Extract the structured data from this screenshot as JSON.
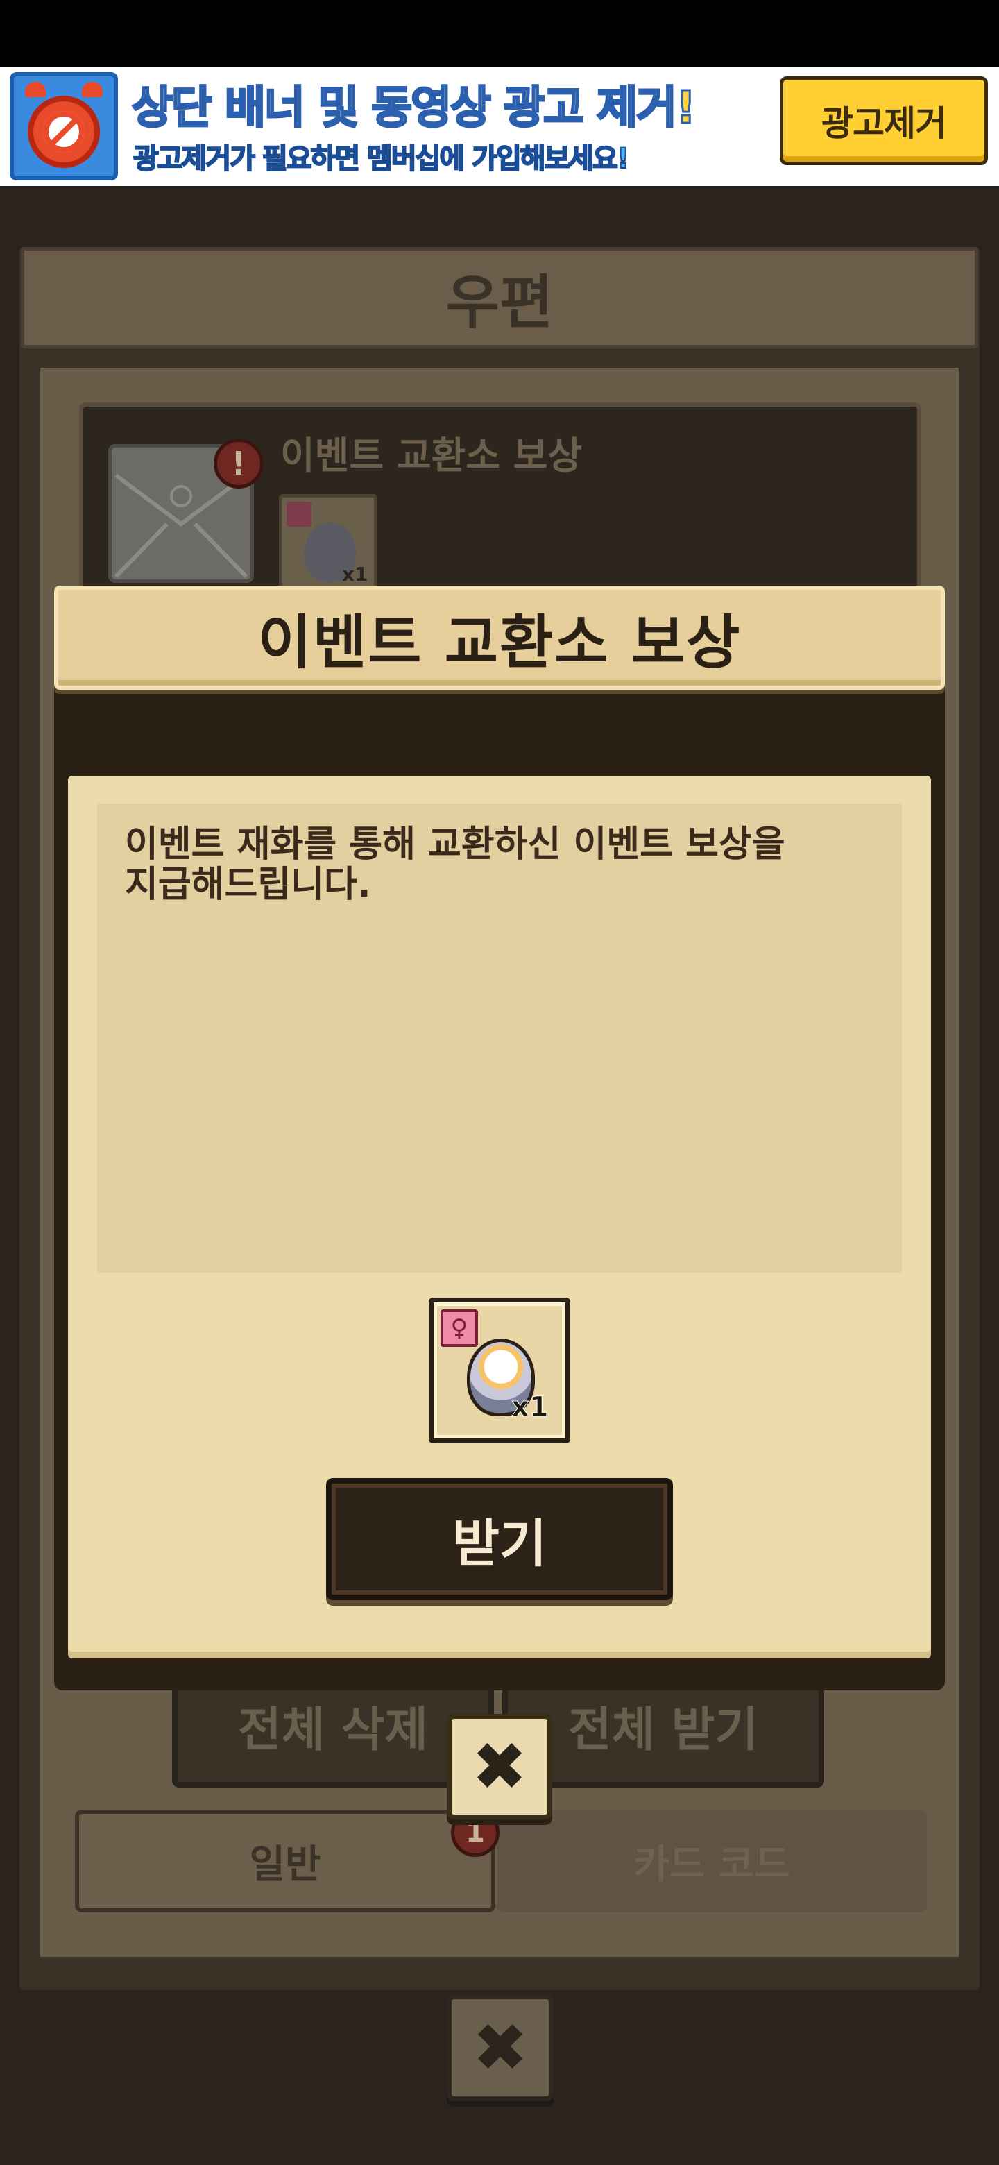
{
  "ad_banner": {
    "icon": "ad-block-clock-icon",
    "title": "상단 배너 및 동영상 광고 제거!",
    "subtitle": "광고제거가 필요하면 멤버십에 가입해보세요!",
    "button_label": "광고제거"
  },
  "mailbox": {
    "title": "우편",
    "mail_item": {
      "title": "이벤트 교환소 보상",
      "alert_badge": "!",
      "item_quantity": "x1"
    },
    "delete_all_label": "전체 삭제",
    "receive_all_label": "전체 받기",
    "close_symbol": "✖",
    "tabs": [
      {
        "label": "일반",
        "badge": "1"
      },
      {
        "label": "카드 코드"
      }
    ]
  },
  "modal": {
    "title": "이벤트 교환소 보상",
    "message": "이벤트 재화를 통해 교환하신 이벤트 보상을\n지급해드립니다.",
    "reward": {
      "gender_icon": "♀",
      "quantity": "x1"
    },
    "receive_label": "받기",
    "close_symbol": "✖"
  },
  "colors": {
    "modal_header": "#e6cf9b",
    "modal_body": "#ecdcab",
    "button_dark": "#2d2218",
    "ad_button": "#ffcf33"
  }
}
